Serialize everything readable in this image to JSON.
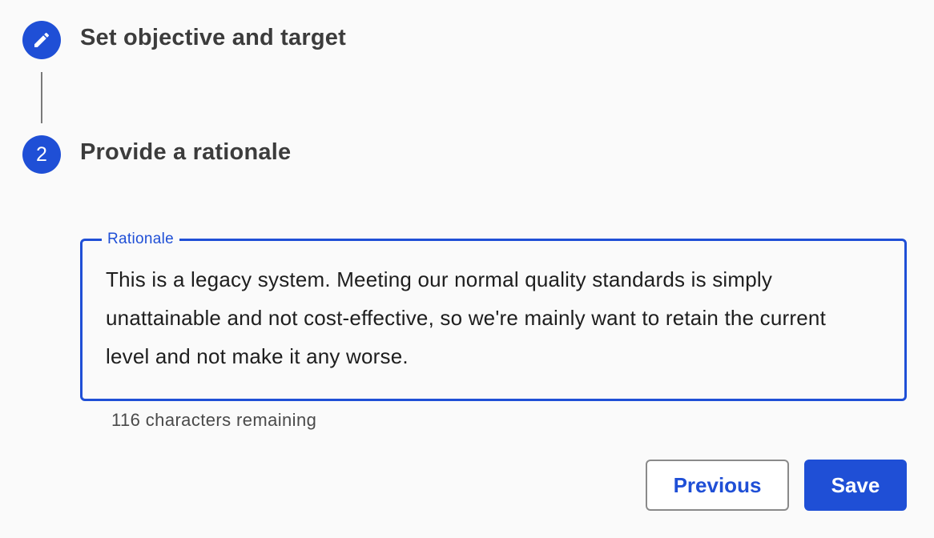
{
  "colors": {
    "accent": "#1f4fd6",
    "background": "#fafafa",
    "connector": "#7a7a7a",
    "title_text": "#3c3c3c",
    "body_text": "#1e1e1e"
  },
  "stepper": {
    "steps": [
      {
        "icon": "pencil-icon",
        "title": "Set objective and target",
        "state": "completed"
      },
      {
        "number": "2",
        "title": "Provide a rationale",
        "state": "active"
      }
    ]
  },
  "rationale": {
    "label": "Rationale",
    "value": "This is a legacy system. Meeting our normal quality standards is simply unattainable and not cost-effective, so we're mainly want to retain the current level and not make it any worse.",
    "helper": "116 characters remaining"
  },
  "actions": {
    "previous_label": "Previous",
    "save_label": "Save"
  }
}
